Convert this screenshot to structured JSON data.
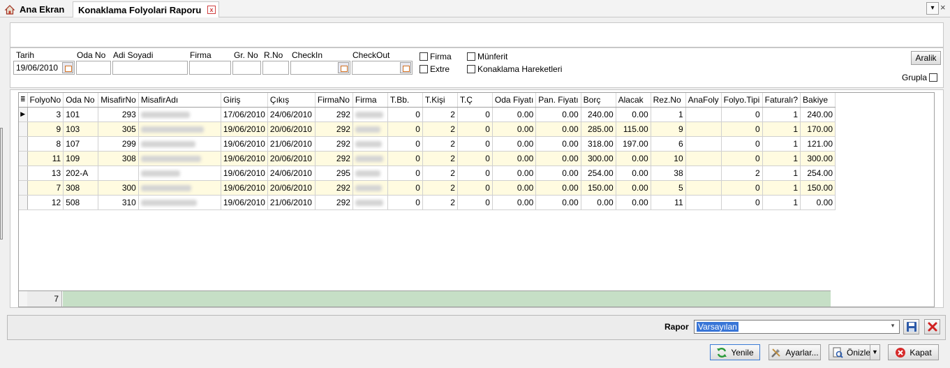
{
  "tabs": {
    "home_label": "Ana Ekran",
    "active_label": "Konaklama Folyolari Raporu",
    "close_glyph": "x"
  },
  "filters": {
    "tarih_label": "Tarih",
    "tarih_value": "19/06/2010",
    "oda_no_label": "Oda No",
    "adi_soyadi_label": "Adi Soyadi",
    "firma_label": "Firma",
    "gr_no_label": "Gr. No",
    "r_no_label": "R.No",
    "checkin_label": "CheckIn",
    "checkout_label": "CheckOut",
    "chk_firma": "Firma",
    "chk_extre": "Extre",
    "chk_munferit": "Münferit",
    "chk_konaklama": "Konaklama Hareketleri",
    "aralik_button": "Aralik",
    "grupla_label": "Grupla"
  },
  "grid": {
    "columns": [
      "FolyoNo",
      "Oda No",
      "MisafirNo",
      "MisafirAdı",
      "Giriş",
      "Çıkış",
      "FirmaNo",
      "Firma",
      "T.Bb.",
      "T.Kişi",
      "T.Ç",
      "Oda Fiyatı",
      "Pan. Fiyatı",
      "Borç",
      "Alacak",
      "Rez.No",
      "AnaFoly",
      "Folyo.Tipi",
      "Faturalı?",
      "Bakiye"
    ],
    "rows": [
      [
        "3",
        "101",
        "293",
        "",
        "17/06/2010",
        "24/06/2010",
        "292",
        "",
        "0",
        "2",
        "0",
        "0.00",
        "0.00",
        "240.00",
        "0.00",
        "1",
        "",
        "0",
        "1",
        "240.00"
      ],
      [
        "9",
        "103",
        "305",
        "",
        "19/06/2010",
        "20/06/2010",
        "292",
        "",
        "0",
        "2",
        "0",
        "0.00",
        "0.00",
        "285.00",
        "115.00",
        "9",
        "",
        "0",
        "1",
        "170.00"
      ],
      [
        "8",
        "107",
        "299",
        "",
        "19/06/2010",
        "21/06/2010",
        "292",
        "",
        "0",
        "2",
        "0",
        "0.00",
        "0.00",
        "318.00",
        "197.00",
        "6",
        "",
        "0",
        "1",
        "121.00"
      ],
      [
        "11",
        "109",
        "308",
        "",
        "19/06/2010",
        "20/06/2010",
        "292",
        "",
        "0",
        "2",
        "0",
        "0.00",
        "0.00",
        "300.00",
        "0.00",
        "10",
        "",
        "0",
        "1",
        "300.00"
      ],
      [
        "13",
        "202-A",
        "",
        "",
        "19/06/2010",
        "24/06/2010",
        "295",
        "",
        "0",
        "2",
        "0",
        "0.00",
        "0.00",
        "254.00",
        "0.00",
        "38",
        "",
        "2",
        "1",
        "254.00"
      ],
      [
        "7",
        "308",
        "300",
        "",
        "19/06/2010",
        "20/06/2010",
        "292",
        "",
        "0",
        "2",
        "0",
        "0.00",
        "0.00",
        "150.00",
        "0.00",
        "5",
        "",
        "0",
        "1",
        "150.00"
      ],
      [
        "12",
        "508",
        "310",
        "",
        "19/06/2010",
        "21/06/2010",
        "292",
        "",
        "0",
        "2",
        "0",
        "0.00",
        "0.00",
        "0.00",
        "0.00",
        "11",
        "",
        "0",
        "1",
        "0.00"
      ]
    ],
    "footer_count": "7"
  },
  "report": {
    "label": "Rapor",
    "selected": "Varsayılan"
  },
  "buttons": {
    "yenile": "Yenile",
    "ayarlar": "Ayarlar...",
    "onizle": "Önizle",
    "kapat": "Kapat"
  }
}
